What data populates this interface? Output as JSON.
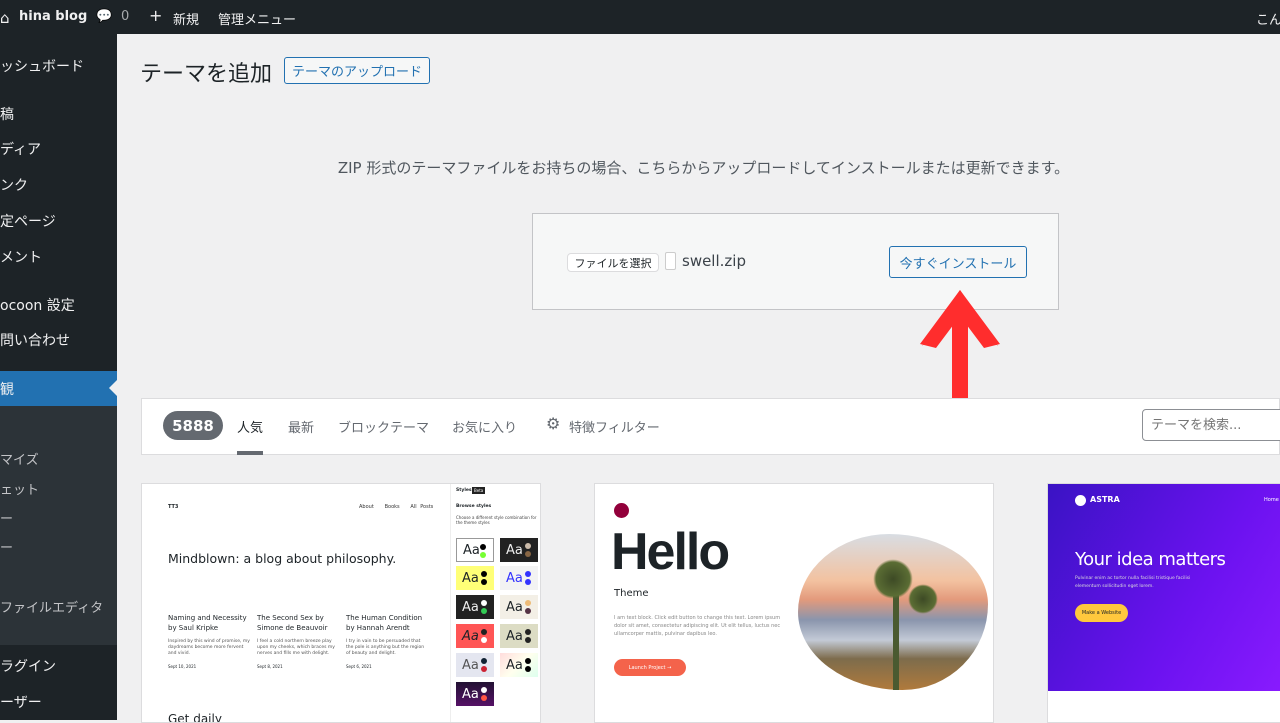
{
  "adminbar": {
    "site": "hina blog",
    "comments": "0",
    "new": "新規",
    "admin_menu": "管理メニュー",
    "greeting": "こん"
  },
  "sidebar": {
    "items": [
      "ッシュボード",
      "稿",
      "ディア",
      "ンク",
      "定ページ",
      "メント",
      "ocoon 設定",
      "問い合わせ",
      "観",
      "マイズ",
      "ェット",
      "ー",
      "ー",
      "ファイルエディタ",
      "ラグイン",
      "ーザー"
    ]
  },
  "page": {
    "title": "テーマを追加",
    "upload_button": "テーマのアップロード",
    "upload_description": "ZIP 形式のテーマファイルをお持ちの場合、こちらからアップロードしてインストールまたは更新できます。"
  },
  "upload": {
    "choose_file": "ファイルを選択",
    "file_name": "swell.zip",
    "install": "今すぐインストール"
  },
  "filter": {
    "count": "5888",
    "tabs": [
      "人気",
      "最新",
      "ブロックテーマ",
      "お気に入り"
    ],
    "feature_filter": "特徴フィルター",
    "search_placeholder": "テーマを検索..."
  },
  "themes": {
    "tt3": {
      "logo": "TT3",
      "nav": [
        "About",
        "Books",
        "All Posts"
      ],
      "headline": "Mindblown: a blog about philosophy.",
      "posts": [
        {
          "title": "Naming and Necessity by Saul Kripke",
          "excerpt": "Inspired by this wind of promise, my daydreams become more fervent and vivid.",
          "date": "Sept 10, 2021"
        },
        {
          "title": "The Second Sex by Simone de Beauvoir",
          "excerpt": "I feel a cold northern breeze play upon my cheeks, which braces my nerves and fills me with delight.",
          "date": "Sept 8, 2021"
        },
        {
          "title": "The Human Condition by Hannah Arendt",
          "excerpt": "I try in vain to be persuaded that the pole is anything but the region of beauty and delight.",
          "date": "Sept 6, 2021"
        }
      ],
      "footer": "Get daily",
      "panel_title": "Styles",
      "panel_badge": "Beta",
      "panel_back": "Browse styles",
      "panel_desc": "Choose a different style combination for the theme styles",
      "swatch": "Aa"
    },
    "hello": {
      "title": "Hello",
      "subtitle": "Theme",
      "text": "I am text block. Click edit button to change this text. Lorem ipsum dolor sit amet, consectetur adipiscing elit. Ut elit tellus, luctus nec ullamcorper mattis, pulvinar dapibus leo.",
      "button": "Launch Project →"
    },
    "astra": {
      "logo": "ASTRA",
      "nav": "Home",
      "headline": "Your idea matters",
      "text": "Pulvinar enim ac tortor nulla facilisi tristique facilisi elementum sollicitudin eget lorem.",
      "button": "Make a Website"
    }
  },
  "colors": {
    "accent": "#2271b1",
    "arrow": "#ff2d2d",
    "adminbar": "#1d2327"
  }
}
